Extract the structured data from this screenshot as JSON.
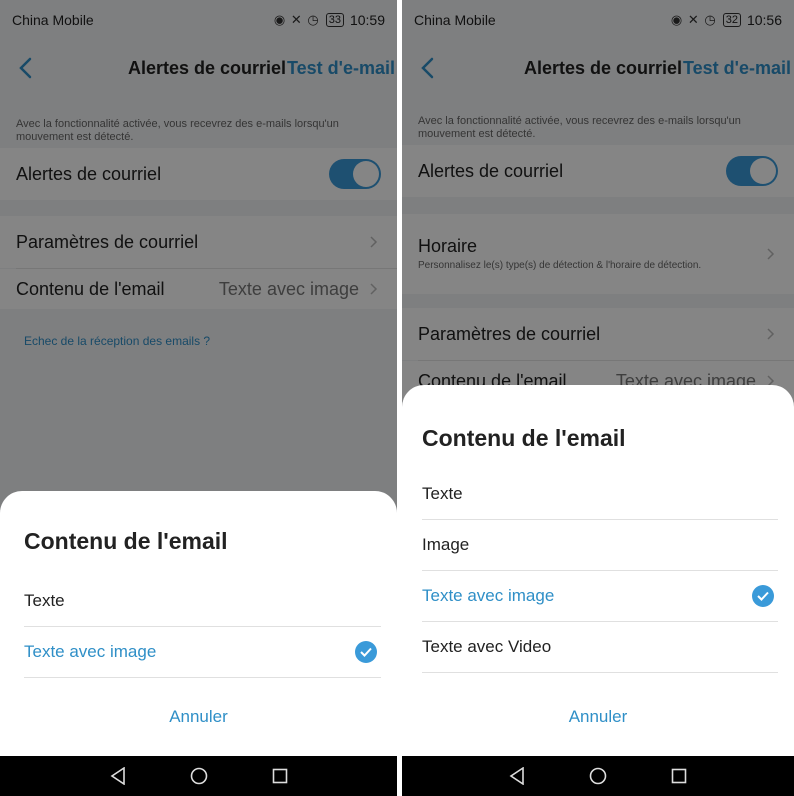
{
  "left": {
    "status": {
      "carrier": "China Mobile",
      "battery": "33",
      "time": "10:59"
    },
    "nav": {
      "title": "Alertes de courriel",
      "action": "Test d'e-mail"
    },
    "description": "Avec la fonctionnalité activée, vous recevrez des e-mails lorsqu'un mouvement est détecté.",
    "email_alerts_label": "Alertes de courriel",
    "email_settings_label": "Paramètres de courriel",
    "email_content_label": "Contenu de l'email",
    "email_content_value": "Texte avec image",
    "failure_link": "Echec de la réception des emails ?",
    "sheet": {
      "title": "Contenu de l'email",
      "options": [
        "Texte",
        "Texte avec image"
      ],
      "selected_index": 1,
      "cancel": "Annuler"
    }
  },
  "right": {
    "status": {
      "carrier": "China Mobile",
      "battery": "32",
      "time": "10:56"
    },
    "nav": {
      "title": "Alertes de courriel",
      "action": "Test d'e-mail"
    },
    "description": "Avec la fonctionnalité activée, vous recevrez des e-mails lorsqu'un mouvement est détecté.",
    "email_alerts_label": "Alertes de courriel",
    "schedule_label": "Horaire",
    "schedule_sub": "Personnalisez le(s) type(s) de détection & l'horaire de détection.",
    "email_settings_label": "Paramètres de courriel",
    "email_content_label": "Contenu de l'email",
    "email_content_value": "Texte avec image",
    "sheet": {
      "title": "Contenu de l'email",
      "options": [
        "Texte",
        "Image",
        "Texte avec image",
        "Texte avec Video"
      ],
      "selected_index": 2,
      "cancel": "Annuler"
    }
  },
  "colors": {
    "accent": "#2f8fc7",
    "toggle": "#3a9ad9"
  }
}
